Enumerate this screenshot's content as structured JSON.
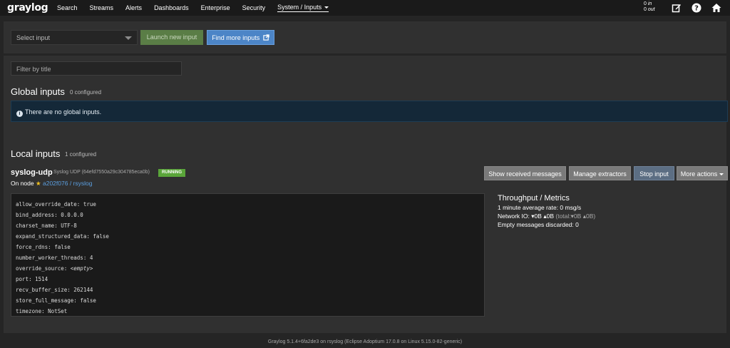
{
  "navbar": {
    "logo": "graylog",
    "items": [
      {
        "label": "Search"
      },
      {
        "label": "Streams"
      },
      {
        "label": "Alerts"
      },
      {
        "label": "Dashboards"
      },
      {
        "label": "Enterprise"
      },
      {
        "label": "Security"
      },
      {
        "label": "System / Inputs"
      }
    ],
    "throughput_in": "0",
    "throughput_in_unit": "in",
    "throughput_out": "0",
    "throughput_out_unit": "out",
    "icons": [
      "edit-icon",
      "help-icon",
      "home-icon"
    ]
  },
  "input_bar": {
    "select_placeholder": "Select input",
    "launch_label": "Launch new input",
    "find_more_label": "Find more inputs"
  },
  "filter": {
    "placeholder": "Filter by title"
  },
  "global_inputs": {
    "title": "Global inputs",
    "count": "0 configured",
    "empty_message": "There are no global inputs."
  },
  "local_inputs": {
    "title": "Local inputs",
    "count": "1 configured",
    "input": {
      "name": "syslog-udp",
      "type": "Syslog UDP",
      "id": "(64efd7550a29c304785eca0b)",
      "status": "RUNNING",
      "on_node_label": "On node",
      "node": "a202f076 / rsyslog",
      "buttons": {
        "show": "Show received messages",
        "extractors": "Manage extractors",
        "stop": "Stop input",
        "more": "More actions"
      },
      "config": [
        {
          "key": "allow_override_date",
          "value": "true"
        },
        {
          "key": "bind_address",
          "value": "0.0.0.0"
        },
        {
          "key": "charset_name",
          "value": "UTF-8"
        },
        {
          "key": "expand_structured_data",
          "value": "false"
        },
        {
          "key": "force_rdns",
          "value": "false"
        },
        {
          "key": "number_worker_threads",
          "value": "4"
        },
        {
          "key": "override_source",
          "value": "<empty>"
        },
        {
          "key": "port",
          "value": "1514"
        },
        {
          "key": "recv_buffer_size",
          "value": "262144"
        },
        {
          "key": "store_full_message",
          "value": "false"
        },
        {
          "key": "timezone",
          "value": "NotSet"
        }
      ],
      "metrics": {
        "title": "Throughput / Metrics",
        "rate": "1 minute average rate: 0 msg/s",
        "network_io_label": "Network IO:",
        "io_in": "0B",
        "io_out": "0B",
        "total_label": "(total:",
        "total_in": "0B",
        "total_out": "0B",
        "total_close": ")",
        "empty_discarded": "Empty messages discarded: 0"
      }
    }
  },
  "footer": "Graylog 5.1.4+6fa2de3 on rsyslog (Eclipse Adoptium 17.0.8 on Linux 5.15.0-82-generic)"
}
